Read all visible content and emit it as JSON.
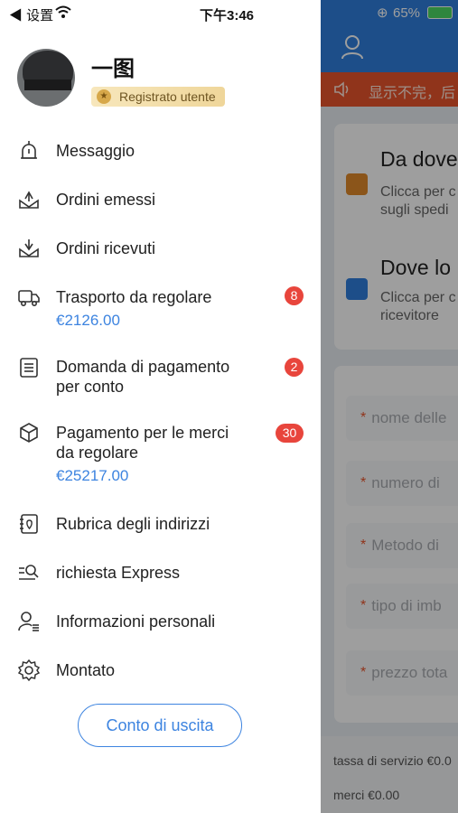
{
  "status_bar": {
    "back_label": "◀ 设置",
    "time": "下午3:46",
    "battery": "65%"
  },
  "profile": {
    "username": "一图",
    "badge_label": "Registrato utente"
  },
  "menu": [
    {
      "id": "messaggio",
      "label": "Messaggio",
      "icon": "bell-icon"
    },
    {
      "id": "ordini-emessi",
      "label": "Ordini emessi",
      "icon": "box-out-icon"
    },
    {
      "id": "ordini-ricevuti",
      "label": "Ordini ricevuti",
      "icon": "box-in-icon"
    },
    {
      "id": "trasporto",
      "label": "Trasporto da regolare",
      "icon": "truck-icon",
      "amount": "€2126.00",
      "badge": "8"
    },
    {
      "id": "domanda",
      "label": "Domanda di pagamento\nper conto",
      "icon": "document-icon",
      "badge": "2"
    },
    {
      "id": "pagamento-merci",
      "label": "Pagamento per le merci\nda regolare",
      "icon": "package-icon",
      "amount": "€25217.00",
      "badge": "30"
    },
    {
      "id": "rubrica",
      "label": "Rubrica degli indirizzi",
      "icon": "address-book-icon"
    },
    {
      "id": "richiesta",
      "label": "richiesta Express",
      "icon": "search-list-icon"
    },
    {
      "id": "info",
      "label": "Informazioni personali",
      "icon": "user-list-icon"
    },
    {
      "id": "montato",
      "label": "Montato",
      "icon": "gear-icon"
    }
  ],
  "logout_label": "Conto di uscita",
  "background": {
    "notice_text": "显示不完，后",
    "card_send_title": "Da dove",
    "card_send_sub_1": "Clicca per c",
    "card_send_sub_2": "sugli spedi",
    "card_recv_title": "Dove lo",
    "card_recv_sub_1": "Clicca per c",
    "card_recv_sub_2": "ricevitore",
    "fields": [
      "nome delle",
      "numero di",
      "Metodo di",
      "tipo di imb",
      "prezzo tota"
    ],
    "field_required_mark": "*",
    "fee_text": "tassa di servizio €0.0",
    "goods_text": "merci €0.00"
  },
  "colors": {
    "accent_blue": "#3d84e0",
    "badge_red": "#e8453c",
    "header_blue": "#2f7fdd",
    "notice_orange": "#e8542c"
  }
}
